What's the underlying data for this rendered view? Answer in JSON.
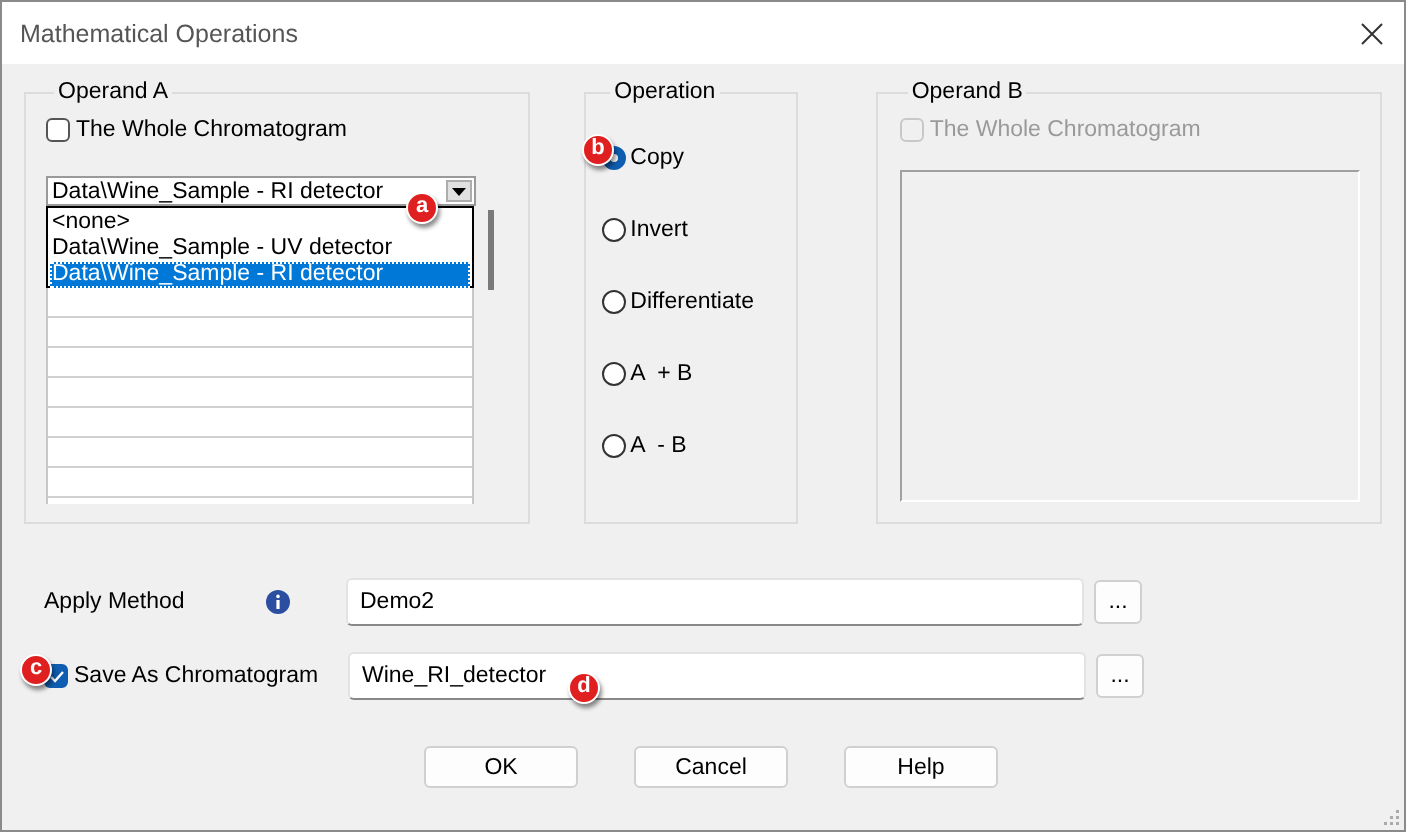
{
  "window": {
    "title": "Mathematical Operations"
  },
  "operand_a": {
    "title": "Operand A",
    "whole_chromatogram": {
      "label": "The Whole Chromatogram",
      "checked": false
    },
    "combo": {
      "value": "Data\\Wine_Sample - RI detector"
    },
    "dropdown_items": [
      {
        "label": "<none>",
        "selected": false
      },
      {
        "label": "Data\\Wine_Sample - UV detector",
        "selected": false
      },
      {
        "label": "Data\\Wine_Sample - RI detector",
        "selected": true
      }
    ]
  },
  "operation": {
    "title": "Operation",
    "options": [
      {
        "label": "Copy",
        "selected": true
      },
      {
        "label": "Invert",
        "selected": false
      },
      {
        "label": "Differentiate",
        "selected": false
      },
      {
        "label": "A  + B",
        "selected": false
      },
      {
        "label": "A  - B",
        "selected": false
      }
    ]
  },
  "operand_b": {
    "title": "Operand B",
    "whole_chromatogram": {
      "label": "The Whole Chromatogram",
      "checked": false,
      "disabled": true
    }
  },
  "apply_method": {
    "label": "Apply Method",
    "value": "Demo2",
    "browse": "..."
  },
  "save_as": {
    "label": "Save As Chromatogram",
    "checked": true,
    "value": "Wine_RI_detector",
    "browse": "..."
  },
  "buttons": [
    "OK",
    "Cancel",
    "Help"
  ],
  "callouts": [
    "a",
    "b",
    "c",
    "d"
  ]
}
